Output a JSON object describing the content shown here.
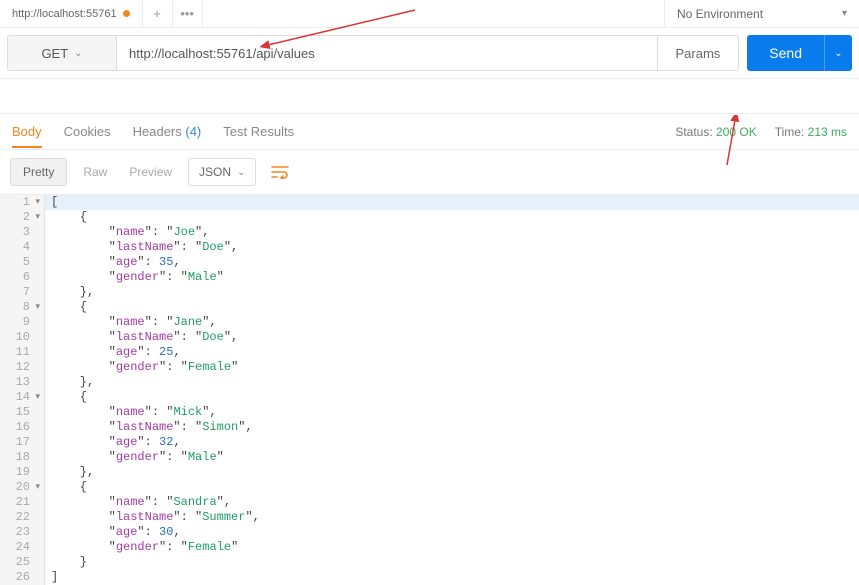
{
  "tab": {
    "title": "http://localhost:55761"
  },
  "env": {
    "label": "No Environment"
  },
  "request": {
    "method": "GET",
    "url": "http://localhost:55761/api/values",
    "params_label": "Params",
    "send_label": "Send"
  },
  "response_tabs": {
    "body": "Body",
    "cookies": "Cookies",
    "headers": "Headers",
    "headers_count": "(4)",
    "test_results": "Test Results"
  },
  "status": {
    "status_label": "Status:",
    "status_value": "200 OK",
    "time_label": "Time:",
    "time_value": "213 ms"
  },
  "view": {
    "pretty": "Pretty",
    "raw": "Raw",
    "preview": "Preview",
    "format": "JSON"
  },
  "lines": {
    "l1": "[",
    "l2": "    {",
    "l3a": "        \"",
    "l3k": "name",
    "l3b": "\": \"",
    "l3v": "Joe",
    "l3c": "\",",
    "l4a": "        \"",
    "l4k": "lastName",
    "l4b": "\": \"",
    "l4v": "Doe",
    "l4c": "\",",
    "l5a": "        \"",
    "l5k": "age",
    "l5b": "\": ",
    "l5v": "35",
    "l5c": ",",
    "l6a": "        \"",
    "l6k": "gender",
    "l6b": "\": \"",
    "l6v": "Male",
    "l6c": "\"",
    "l7": "    },",
    "l8": "    {",
    "l9a": "        \"",
    "l9k": "name",
    "l9b": "\": \"",
    "l9v": "Jane",
    "l9c": "\",",
    "l10a": "        \"",
    "l10k": "lastName",
    "l10b": "\": \"",
    "l10v": "Doe",
    "l10c": "\",",
    "l11a": "        \"",
    "l11k": "age",
    "l11b": "\": ",
    "l11v": "25",
    "l11c": ",",
    "l12a": "        \"",
    "l12k": "gender",
    "l12b": "\": \"",
    "l12v": "Female",
    "l12c": "\"",
    "l13": "    },",
    "l14": "    {",
    "l15a": "        \"",
    "l15k": "name",
    "l15b": "\": \"",
    "l15v": "Mick",
    "l15c": "\",",
    "l16a": "        \"",
    "l16k": "lastName",
    "l16b": "\": \"",
    "l16v": "Simon",
    "l16c": "\",",
    "l17a": "        \"",
    "l17k": "age",
    "l17b": "\": ",
    "l17v": "32",
    "l17c": ",",
    "l18a": "        \"",
    "l18k": "gender",
    "l18b": "\": \"",
    "l18v": "Male",
    "l18c": "\"",
    "l19": "    },",
    "l20": "    {",
    "l21a": "        \"",
    "l21k": "name",
    "l21b": "\": \"",
    "l21v": "Sandra",
    "l21c": "\",",
    "l22a": "        \"",
    "l22k": "lastName",
    "l22b": "\": \"",
    "l22v": "Summer",
    "l22c": "\",",
    "l23a": "        \"",
    "l23k": "age",
    "l23b": "\": ",
    "l23v": "30",
    "l23c": ",",
    "l24a": "        \"",
    "l24k": "gender",
    "l24b": "\": \"",
    "l24v": "Female",
    "l24c": "\"",
    "l25": "    }",
    "l26": "]"
  }
}
